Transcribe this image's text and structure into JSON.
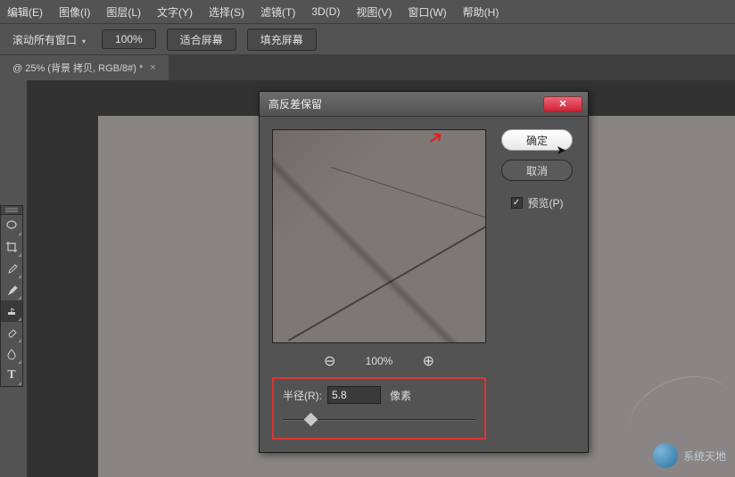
{
  "menubar": {
    "items": [
      "编辑(E)",
      "图像(I)",
      "图层(L)",
      "文字(Y)",
      "选择(S)",
      "滤镜(T)",
      "3D(D)",
      "视图(V)",
      "窗口(W)",
      "帮助(H)"
    ]
  },
  "toolbar": {
    "scroll_label": "滚动所有窗口",
    "zoom_pct": "100%",
    "fit_screen": "适合屏幕",
    "fill_screen": "填充屏幕"
  },
  "tab": {
    "title": "@ 25% (背景 拷贝, RGB/8#) *",
    "close": "×"
  },
  "dialog": {
    "title": "高反差保留",
    "ok": "确定",
    "cancel": "取消",
    "preview_label": "预览(P)",
    "zoom_pct": "100%",
    "radius_label": "半径(R):",
    "radius_value": "5.8",
    "radius_unit": "像素"
  },
  "watermark": {
    "text": "系统天地"
  }
}
